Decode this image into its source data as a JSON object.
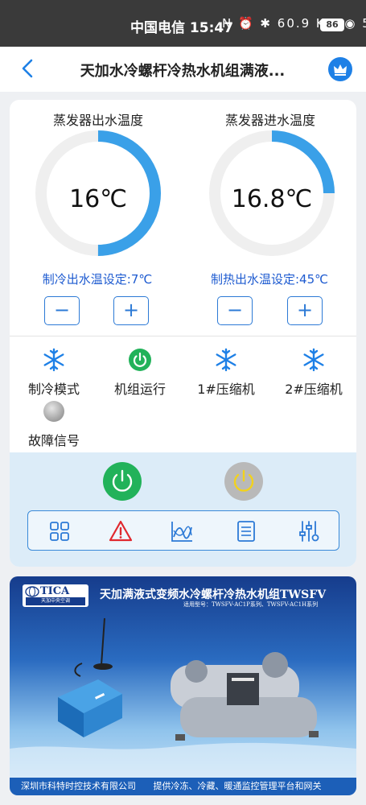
{
  "statusbar": {
    "carrier_time": "中国电信 15:47",
    "icons": "N ⏰ ✱ 60.9 K/s ◉ 5G",
    "battery": "86"
  },
  "appbar": {
    "title": "天加水冷螺杆冷热水机组满液..."
  },
  "gauges": [
    {
      "label": "蒸发器出水温度",
      "value": "16℃",
      "setpoint": "制冷出水温设定:7℃",
      "fill": 0.5
    },
    {
      "label": "蒸发器进水温度",
      "value": "16.8℃",
      "setpoint": "制热出水温设定:45℃",
      "fill": 0.25
    }
  ],
  "stepper": {
    "minus": "−",
    "plus": "+"
  },
  "statuses": [
    {
      "label": "制冷模式"
    },
    {
      "label": "机组运行"
    },
    {
      "label": "1#压缩机"
    },
    {
      "label": "2#压缩机"
    },
    {
      "label": "故障信号"
    }
  ],
  "banner": {
    "logo": "TICA",
    "logo_sub": "天加中央空调",
    "title": "天加满液式变频水冷螺杆冷热水机组TWSFV",
    "subtitle": "适用型号：TWSFV-AC1P系列、TWSFV-AC1H系列",
    "footer_left": "深圳市科特时控技术有限公司",
    "footer_right": "提供冷冻、冷藏、暖通监控管理平台和网关"
  },
  "colors": {
    "accent": "#1e80e6",
    "arc": "#3aa0e8",
    "running": "#22b25a",
    "fault": "#b9b9b9",
    "alarm": "#e0282e"
  }
}
